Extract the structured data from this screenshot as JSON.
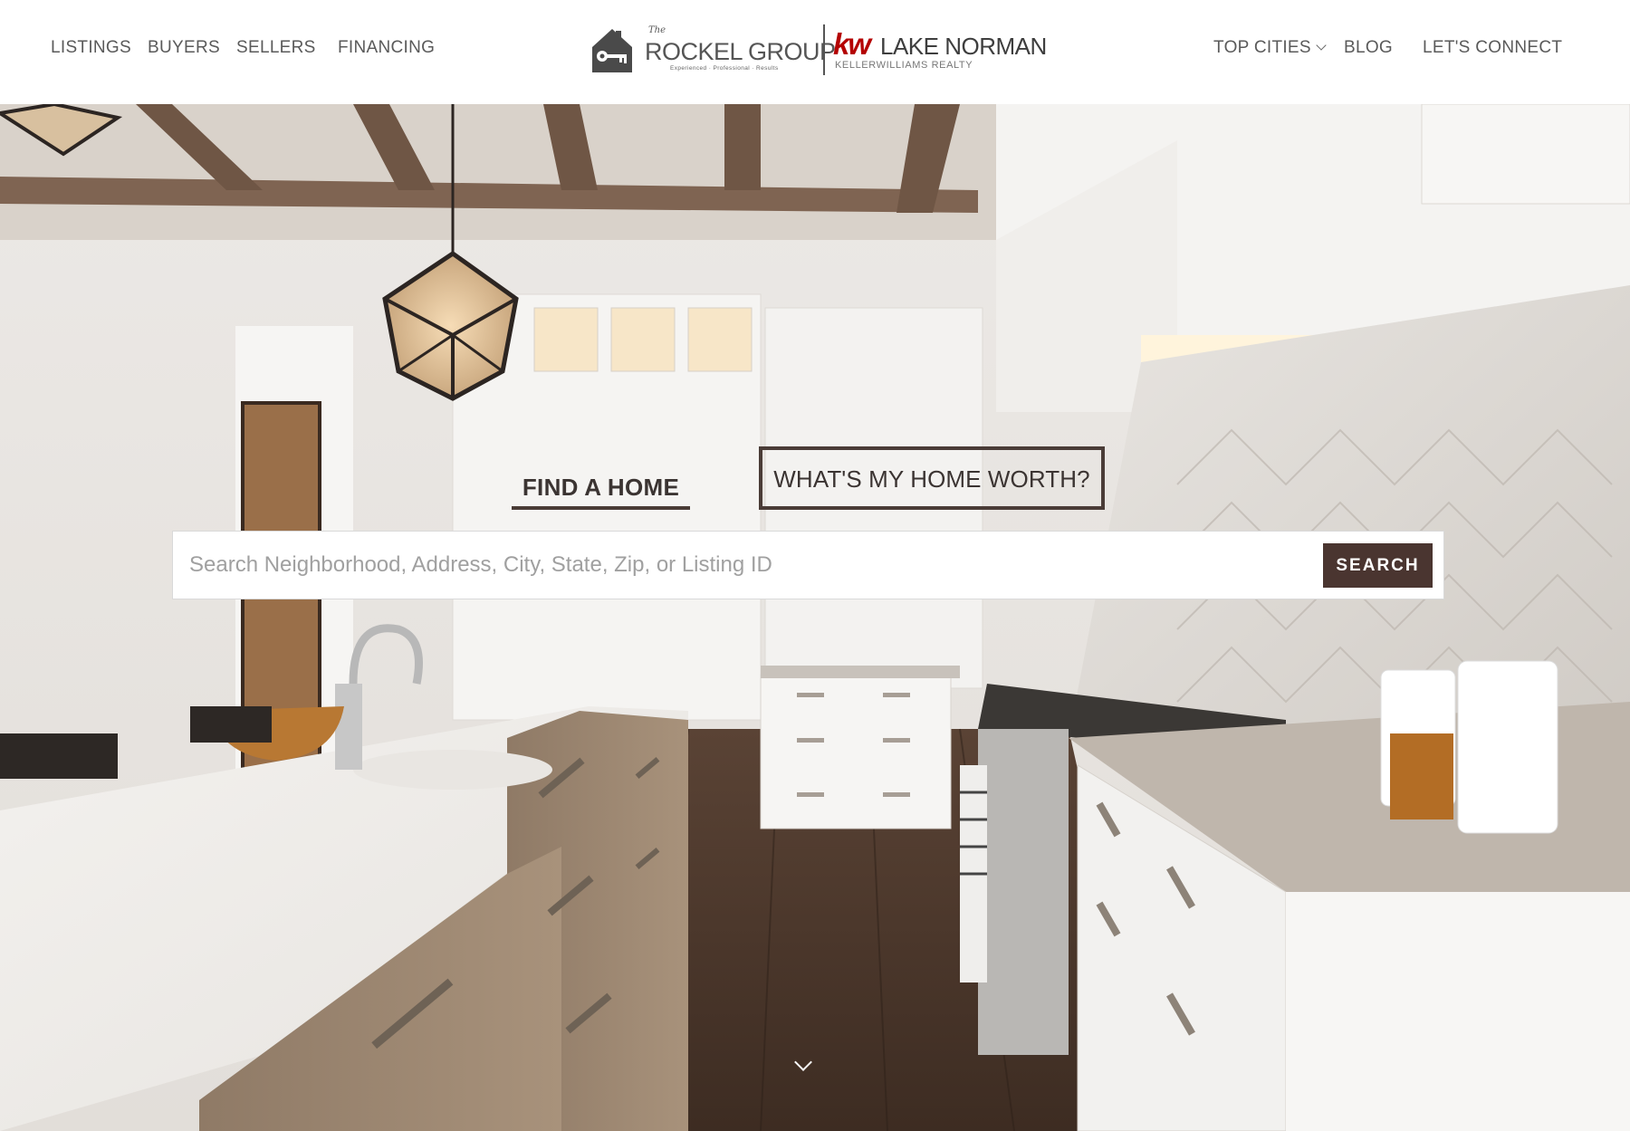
{
  "nav": {
    "listings": "LISTINGS",
    "buyers": "BUYERS",
    "sellers": "SELLERS",
    "financing": "FINANCING",
    "top_cities": "TOP CITIES",
    "blog": "BLOG",
    "lets_connect": "LET'S CONNECT"
  },
  "logo": {
    "the": "The",
    "group_name": "ROCKEL GROUP",
    "tagline": "Experienced · Professional · Results",
    "kw": "kw",
    "market": "LAKE NORMAN",
    "brokerage": "KELLERWILLIAMS REALTY",
    "house_icon": "house-key-icon",
    "brand_red": "#b40101"
  },
  "hero": {
    "tab_find": "FIND A HOME",
    "tab_worth": "WHAT'S MY HOME WORTH?",
    "search_placeholder": "Search Neighborhood, Address, City, State, Zip, or Listing ID",
    "search_value": "",
    "search_button": "SEARCH",
    "scroll_icon": "chevron-down-icon",
    "accent": "#4a3530"
  }
}
